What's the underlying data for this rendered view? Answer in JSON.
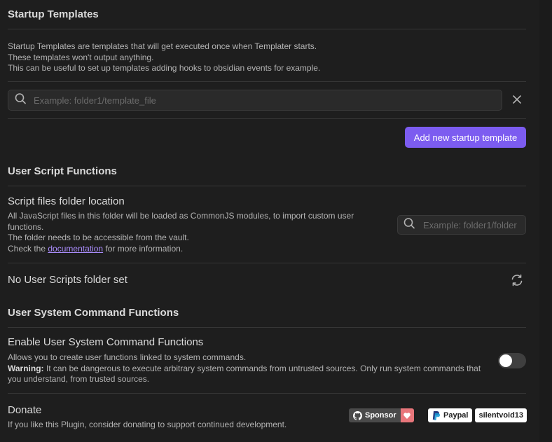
{
  "startup": {
    "heading": "Startup Templates",
    "desc_lines": [
      "Startup Templates are templates that will get executed once when Templater starts.",
      "These templates won't output anything.",
      "This can be useful to set up templates adding hooks to obsidian events for example."
    ],
    "search_placeholder": "Example: folder1/template_file",
    "search_value": "",
    "add_button_label": "Add new startup template",
    "icons": {
      "search": "search-icon",
      "remove": "close-icon"
    }
  },
  "user_scripts": {
    "heading": "User Script Functions",
    "setting_name": "Script files folder location",
    "desc_line1": "All JavaScript files in this folder will be loaded as CommonJS modules, to import custom user",
    "desc_line2": "functions.",
    "desc_line3": "The folder needs to be accessible from the vault.",
    "desc_line4_prefix": "Check the ",
    "desc_link": "documentation",
    "desc_line4_suffix": " for more information.",
    "folder_placeholder": "Example: folder1/folder",
    "folder_value": "",
    "no_folder_text": "No User Scripts folder set",
    "icons": {
      "search": "search-icon",
      "refresh": "refresh-icon"
    }
  },
  "system_commands": {
    "heading": "User System Command Functions",
    "setting_name": "Enable User System Command Functions",
    "desc_line1": "Allows you to create user functions linked to system commands.",
    "warning_label": "Warning:",
    "warning_text": " It can be dangerous to execute arbitrary system commands from untrusted sources. Only run system commands that",
    "desc_line3": "you understand, from trusted sources.",
    "enabled": false
  },
  "donate": {
    "setting_name": "Donate",
    "desc": "If you like this Plugin, consider donating to support continued development.",
    "sponsor_label": "Sponsor",
    "paypal_label": "Paypal",
    "paypal_user": "silentvoid13",
    "icons": {
      "github": "github-icon",
      "heart": "heart-icon",
      "paypal": "paypal-icon"
    }
  },
  "colors": {
    "background": "#1e1e1e",
    "accent": "#7c5cf0",
    "link": "#a88bfa",
    "text": "#dadada",
    "muted": "#b3b3b3"
  }
}
